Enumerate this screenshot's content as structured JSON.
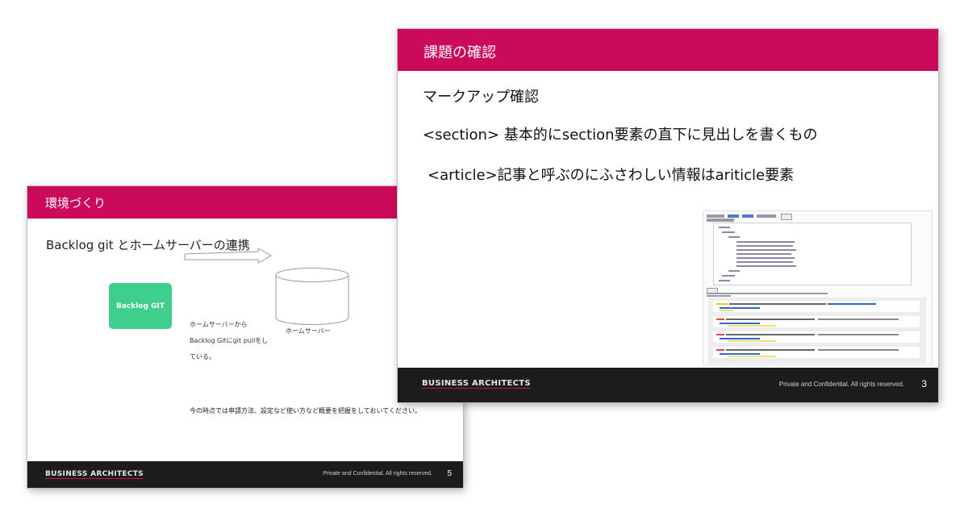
{
  "slide1": {
    "title": "環境づくり",
    "subtitle": "Backlog git とホームサーバーの連携",
    "git_box_label": "Backlog GIT",
    "server_label": "ホームサーバー",
    "desc_lines": [
      "ホームサーバーから",
      "Backlog Gitにgit pullをし",
      "ている。"
    ],
    "note": "今の時点では申請方法、設定など使い方など概要を把握をしておいてください。",
    "footer_logo": "BUSINESS ARCHITECTS",
    "footer_rights": "Private and Confidential. All rights reserved.",
    "page_number": "5"
  },
  "slide2": {
    "title": "課題の確認",
    "line1": "マークアップ確認",
    "line2": "<section> 基本的にsection要素の直下に見出しを書くもの",
    "line3": "<article>記事と呼ぶのにふさわしい情報はariticle要素",
    "footer_logo": "BUSINESS ARCHITECTS",
    "footer_rights": "Private and Confidential. All rights reserved.",
    "page_number": "3"
  },
  "colors": {
    "accent": "#cc0a5c",
    "footer": "#1c1c1c",
    "git_box": "#3ecf8e"
  }
}
